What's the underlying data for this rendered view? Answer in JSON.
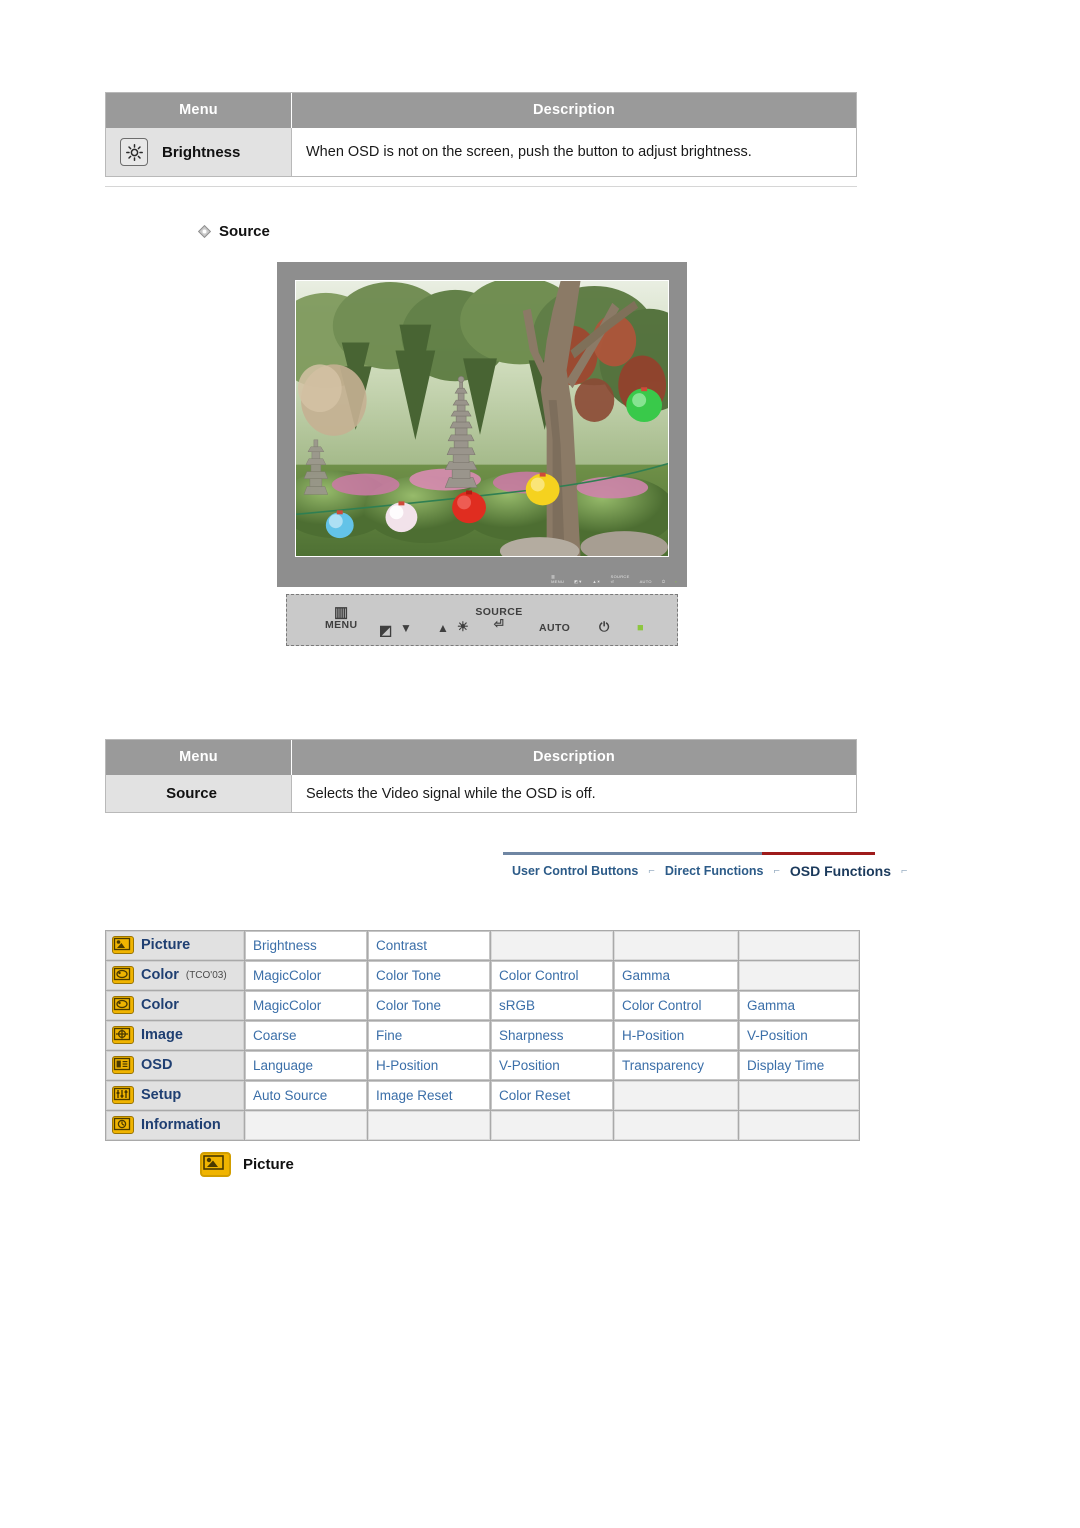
{
  "tables": {
    "headers": {
      "menu": "Menu",
      "description": "Description"
    },
    "brightness_row": {
      "icon": "brightness-sun-icon",
      "label": "Brightness",
      "description": "When OSD is not on the screen, push the button to adjust brightness."
    },
    "source_row": {
      "label": "Source",
      "description": "Selects the Video signal while the OSD is off."
    }
  },
  "section": {
    "source_heading": "Source"
  },
  "monitor": {
    "osd_labels": [
      "MENU",
      "AUTO",
      "SOURCE",
      "AUTO",
      "POWER"
    ]
  },
  "panel": {
    "menu_label": "MENU",
    "menu_glyph": "▥",
    "down_glyph": "▼",
    "magic_glyph": "◩",
    "up_glyph": "▲",
    "brightness_glyph": "☀",
    "source_label": "SOURCE",
    "source_glyph": "⏎",
    "auto_label": "AUTO",
    "power_glyph": "⏻",
    "led_color": "#8dc63f"
  },
  "nav": {
    "items": [
      {
        "label": "User Control Buttons",
        "active": false
      },
      {
        "label": "Direct Functions",
        "active": false
      },
      {
        "label": "OSD Functions",
        "active": true
      }
    ],
    "separator": "⌐",
    "accent_color": "#9e1b1b",
    "line_color": "#6f86a3",
    "link_color": "#2c5b88"
  },
  "osd_table": {
    "rows": [
      {
        "icon": "picture-icon",
        "category": "Picture",
        "sub": "",
        "items": [
          "Brightness",
          "Contrast",
          "",
          "",
          ""
        ]
      },
      {
        "icon": "color-icon",
        "category": "Color",
        "sub": "(TCO'03)",
        "items": [
          "MagicColor",
          "Color Tone",
          "Color Control",
          "Gamma",
          ""
        ]
      },
      {
        "icon": "color-icon",
        "category": "Color",
        "sub": "",
        "items": [
          "MagicColor",
          "Color Tone",
          "sRGB",
          "Color Control",
          "Gamma"
        ]
      },
      {
        "icon": "image-icon",
        "category": "Image",
        "sub": "",
        "items": [
          "Coarse",
          "Fine",
          "Sharpness",
          "H-Position",
          "V-Position"
        ]
      },
      {
        "icon": "osd-icon",
        "category": "OSD",
        "sub": "",
        "items": [
          "Language",
          "H-Position",
          "V-Position",
          "Transparency",
          "Display Time"
        ]
      },
      {
        "icon": "setup-icon",
        "category": "Setup",
        "sub": "",
        "items": [
          "Auto Source",
          "Image Reset",
          "Color Reset",
          "",
          ""
        ]
      },
      {
        "icon": "information-icon",
        "category": "Information",
        "sub": "",
        "items": [
          "",
          "",
          "",
          "",
          ""
        ]
      }
    ]
  },
  "footer": {
    "picture_icon": "picture-icon",
    "picture_label": "Picture"
  }
}
